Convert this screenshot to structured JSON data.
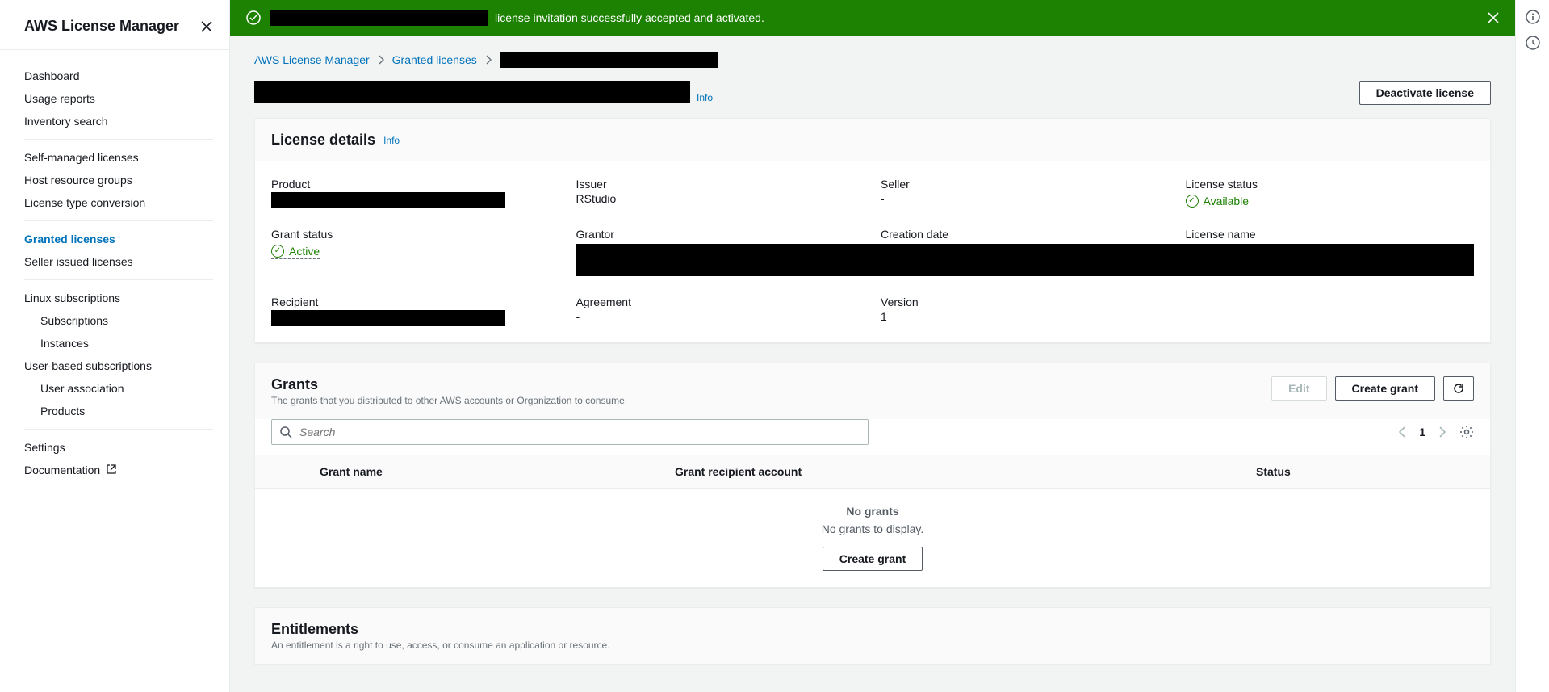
{
  "sidebar": {
    "title": "AWS License Manager",
    "sections": [
      {
        "items": [
          "Dashboard",
          "Usage reports",
          "Inventory search"
        ]
      },
      {
        "items": [
          "Self-managed licenses",
          "Host resource groups",
          "License type conversion"
        ]
      },
      {
        "items": [
          "Granted licenses",
          "Seller issued licenses"
        ],
        "activeIndex": 0
      },
      {
        "items": [
          "Linux subscriptions"
        ],
        "sub": [
          "Subscriptions",
          "Instances"
        ],
        "items2": [
          "User-based subscriptions"
        ],
        "sub2": [
          "User association",
          "Products"
        ]
      },
      {
        "items": [
          "Settings",
          "Documentation"
        ],
        "extIndex": 1
      }
    ]
  },
  "flash": {
    "message": "license invitation successfully accepted and activated."
  },
  "breadcrumb": {
    "root": "AWS License Manager",
    "parent": "Granted licenses"
  },
  "page": {
    "info": "Info",
    "deactivate": "Deactivate license"
  },
  "details": {
    "title": "License details",
    "info": "Info",
    "fields": {
      "product": "Product",
      "issuer": "Issuer",
      "issuer_val": "RStudio",
      "seller": "Seller",
      "seller_val": "-",
      "license_status": "License status",
      "license_status_val": "Available",
      "grant_status": "Grant status",
      "grant_status_val": "Active",
      "grantor": "Grantor",
      "creation_date": "Creation date",
      "license_name": "License name",
      "recipient": "Recipient",
      "agreement": "Agreement",
      "agreement_val": "-",
      "version": "Version",
      "version_val": "1"
    }
  },
  "grants": {
    "title": "Grants",
    "subtitle": "The grants that you distributed to other AWS accounts or Organization to consume.",
    "edit": "Edit",
    "create": "Create grant",
    "search_placeholder": "Search",
    "page": "1",
    "columns": {
      "name": "Grant name",
      "recipient": "Grant recipient account",
      "status": "Status"
    },
    "empty_title": "No grants",
    "empty_sub": "No grants to display.",
    "empty_btn": "Create grant"
  },
  "entitlements": {
    "title": "Entitlements",
    "subtitle": "An entitlement is a right to use, access, or consume an application or resource."
  }
}
